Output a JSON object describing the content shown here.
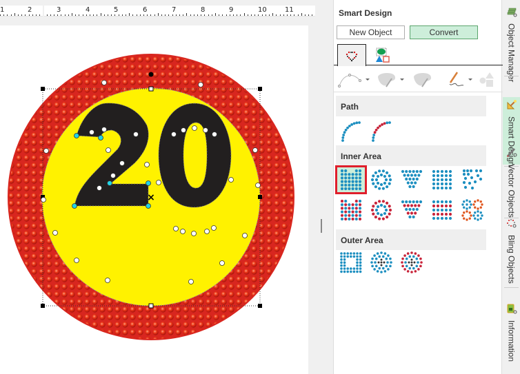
{
  "ruler": {
    "labels": [
      "1",
      "2",
      "3",
      "4",
      "5",
      "6",
      "7",
      "8",
      "9",
      "10",
      "11"
    ]
  },
  "canvas": {
    "sign_text": "20",
    "colors": {
      "outer_ring": "#d8261f",
      "rhinestone": "#f03a18",
      "inner_fill": "#fff200",
      "digits": "#221f1f",
      "node_white": "#ffffff",
      "node_selected": "#22d3e6"
    }
  },
  "panel": {
    "title": "Smart Design",
    "new_object_label": "New Object",
    "convert_label": "Convert",
    "tabs": [
      {
        "name": "bling-shape-tab",
        "icon": "heart-dots-icon",
        "active": true
      },
      {
        "name": "vector-shape-tab",
        "icon": "shapes-icon",
        "active": false
      }
    ],
    "tools": [
      {
        "icon": "bezier-curve-icon",
        "has_dropdown": true
      },
      {
        "icon": "fill-palette-icon",
        "has_dropdown": true
      },
      {
        "icon": "fill-palette-alt-icon",
        "has_dropdown": false
      },
      {
        "icon": "freehand-pen-icon",
        "has_dropdown": true
      },
      {
        "icon": "basic-shapes-icon",
        "has_dropdown": false
      }
    ],
    "sections": {
      "path": {
        "label": "Path",
        "items": [
          "arc-path-blue",
          "arc-path-blue-red"
        ]
      },
      "inner_area": {
        "label": "Inner Area",
        "items": [
          "grid-fill-blue",
          "ring-fill-blue",
          "fan-fill-blue",
          "rows-fill-blue",
          "scatter-fill-blue",
          "grid-fill-red-blue",
          "ring-fill-red-blue",
          "fan-fill-red-blue",
          "rows-fill-red-blue",
          "diamond-fill-blue-orange"
        ],
        "selected_index": 0
      },
      "outer_area": {
        "label": "Outer Area",
        "items": [
          "star-outer-blue",
          "concentric-outer-blue",
          "concentric-outer-red"
        ]
      }
    }
  },
  "side_tabs": [
    {
      "label": "Object Manager",
      "icon": "layers-icon",
      "active": false
    },
    {
      "label": "Smart Design",
      "icon": "magic-wand-icon",
      "active": true
    },
    {
      "label": "Vector Objects",
      "icon": "pencil-icon",
      "active": false
    },
    {
      "label": "Bling Objects",
      "icon": "rhinestone-icon",
      "active": false
    },
    {
      "label": "Information",
      "icon": "info-icon",
      "active": false
    }
  ]
}
